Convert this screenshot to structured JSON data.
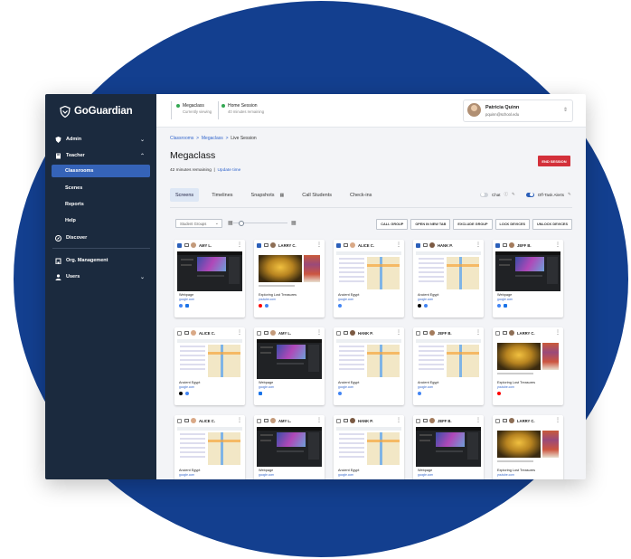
{
  "brand": {
    "name": "GoGuardian"
  },
  "sidebar": {
    "items": [
      {
        "label": "Admin",
        "icon": "shield-icon",
        "expand": true
      },
      {
        "label": "Teacher",
        "icon": "book-icon",
        "expand": true
      },
      {
        "label": "Discover",
        "icon": "compass-icon",
        "expand": false
      },
      {
        "label": "Org. Management",
        "icon": "building-icon",
        "expand": false
      },
      {
        "label": "Users",
        "icon": "user-icon",
        "expand": true
      }
    ],
    "teacher_sub": [
      "Classrooms",
      "Scenes",
      "Reports",
      "Help"
    ]
  },
  "topbar": {
    "sessions": [
      {
        "title": "Megaclass",
        "sub": "Currently viewing"
      },
      {
        "title": "Home Session",
        "sub": "40 minutes remaining"
      }
    ],
    "user": {
      "name": "Patricia Quinn",
      "email": "pquinn@school.edu"
    }
  },
  "page": {
    "breadcrumb": [
      "Classrooms",
      "Megaclass",
      "Live Session"
    ],
    "title": "Megaclass",
    "remaining": "42 minutes remaining",
    "update_link": "Update time",
    "end_button": "END SESSION"
  },
  "tabs": [
    "Screens",
    "Timelines",
    "Snapshots",
    "Call Students",
    "Check-ins"
  ],
  "toggles": {
    "chat": "Chat",
    "offtask": "Off-Task Alerts"
  },
  "controls": {
    "group_select": "Student Groups",
    "buttons": [
      "CALL GROUP",
      "OPEN IN NEW TAB",
      "EXCLUDE GROUP",
      "LOCK DEVICES",
      "UNLOCK DEVICES"
    ]
  },
  "students": [
    {
      "name": "AMY L.",
      "checked": true,
      "shot": "dark",
      "caption": "Webpage",
      "source": "google.com",
      "avatar": "#c39a7a"
    },
    {
      "name": "LARRY C.",
      "checked": true,
      "shot": "gold",
      "caption": "Exploring Lost Treasures",
      "source": "youtube.com",
      "avatar": "#8d6e55"
    },
    {
      "name": "ALICE C.",
      "checked": true,
      "shot": "map",
      "caption": "Ancient Egypt",
      "source": "google.com",
      "avatar": "#d9a987"
    },
    {
      "name": "HANK P.",
      "checked": true,
      "shot": "map",
      "caption": "Ancient Egypt",
      "source": "google.com",
      "avatar": "#7b5a43"
    },
    {
      "name": "JEFF B.",
      "checked": true,
      "shot": "dark",
      "caption": "Webpage",
      "source": "google.com",
      "avatar": "#a37b5c"
    },
    {
      "name": "ALICE C.",
      "checked": false,
      "shot": "map",
      "caption": "Ancient Egypt",
      "source": "google.com",
      "avatar": "#d9a987"
    },
    {
      "name": "AMY L.",
      "checked": false,
      "shot": "dark",
      "caption": "Webpage",
      "source": "google.com",
      "avatar": "#c39a7a"
    },
    {
      "name": "HANK P.",
      "checked": false,
      "shot": "map",
      "caption": "Ancient Egypt",
      "source": "google.com",
      "avatar": "#7b5a43"
    },
    {
      "name": "JEFF B.",
      "checked": false,
      "shot": "map",
      "caption": "Ancient Egypt",
      "source": "google.com",
      "avatar": "#a37b5c"
    },
    {
      "name": "LARRY C.",
      "checked": false,
      "shot": "gold",
      "caption": "Exploring Lost Treasures",
      "source": "youtube.com",
      "avatar": "#8d6e55"
    },
    {
      "name": "ALICE C.",
      "checked": false,
      "shot": "map",
      "caption": "Ancient Egypt",
      "source": "google.com",
      "avatar": "#d9a987"
    },
    {
      "name": "AMY L.",
      "checked": false,
      "shot": "dark",
      "caption": "Webpage",
      "source": "google.com",
      "avatar": "#c39a7a"
    },
    {
      "name": "HANK P.",
      "checked": false,
      "shot": "map",
      "caption": "Ancient Egypt",
      "source": "google.com",
      "avatar": "#7b5a43"
    },
    {
      "name": "JEFF B.",
      "checked": false,
      "shot": "dark",
      "caption": "Webpage",
      "source": "google.com",
      "avatar": "#a37b5c"
    },
    {
      "name": "LARRY C.",
      "checked": false,
      "shot": "gold",
      "caption": "Exploring Lost Treasures",
      "source": "youtube.com",
      "avatar": "#8d6e55"
    }
  ],
  "colors": {
    "accent": "#3563b8",
    "sidebar_bg": "#1b2a3e",
    "end_button": "#d3303a",
    "circle": "#133f8f"
  }
}
